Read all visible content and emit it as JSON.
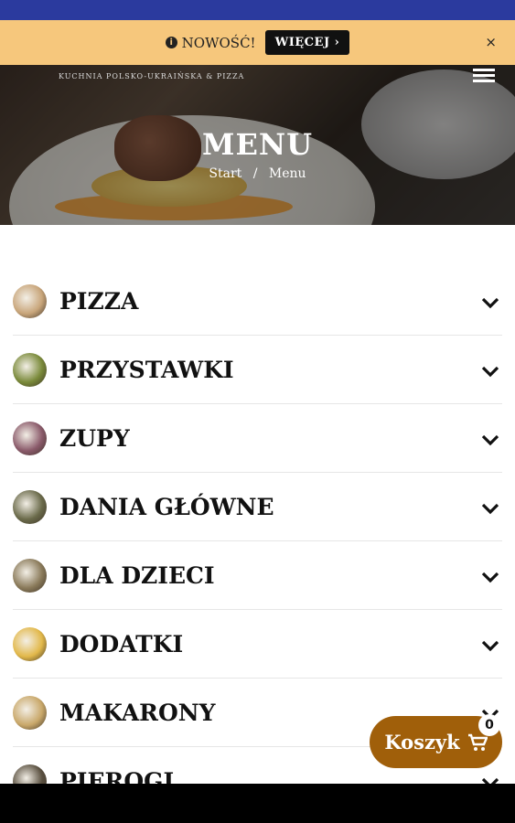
{
  "promo": {
    "label": "NOWOŚĆ!",
    "button": "WIĘCEJ ›",
    "close": "×"
  },
  "hero": {
    "brand": "KUCHNIA POLSKO-UKRAIŃSKA & PIZZA",
    "title": "MENU",
    "breadcrumb": {
      "home": "Start",
      "separator": "/",
      "current": "Menu"
    }
  },
  "menu": {
    "categories": [
      {
        "label": "PIZZA",
        "color": "#c8a57a"
      },
      {
        "label": "PRZYSTAWKI",
        "color": "#7a8a3a"
      },
      {
        "label": "ZUPY",
        "color": "#8a5a6a"
      },
      {
        "label": "DANIA GŁÓWNE",
        "color": "#6a6a4a"
      },
      {
        "label": "DLA DZIECI",
        "color": "#8a7a5a"
      },
      {
        "label": "DODATKI",
        "color": "#e2b84a"
      },
      {
        "label": "MAKARONY",
        "color": "#c9a86a"
      },
      {
        "label": "PIEROGI",
        "color": "#5a5040"
      }
    ]
  },
  "cart": {
    "label": "Koszyk",
    "count": "0",
    "icon": "cart-icon"
  }
}
